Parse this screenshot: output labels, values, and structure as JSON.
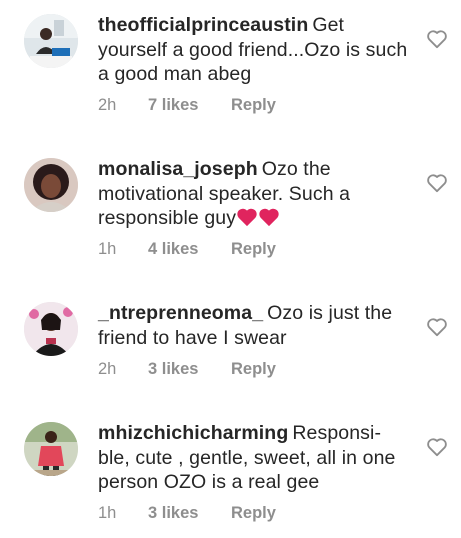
{
  "comments": [
    {
      "username": "theofficialprinceaustin",
      "text": "Get yourself a good friend...Ozo is such a good man abeg",
      "time": "2h",
      "likes": "7 likes",
      "reply": "Reply",
      "avatar_icon": "avatar-photo"
    },
    {
      "username": "monalisa_joseph",
      "text": "Ozo the motivational speaker. Such a responsible guy",
      "emoji": "❤️❤️",
      "time": "1h",
      "likes": "4 likes",
      "reply": "Reply",
      "avatar_icon": "avatar-photo"
    },
    {
      "username": "_ntreprenneoma_",
      "text": "Ozo is just the friend to have I swear",
      "time": "2h",
      "likes": "3 likes",
      "reply": "Reply",
      "avatar_icon": "avatar-photo"
    },
    {
      "username": "mhizchichicharming",
      "text": "Responsi- ble, cute , gentle, sweet, all in one person OZO is a real gee",
      "time": "1h",
      "likes": "3 likes",
      "reply": "Reply",
      "avatar_icon": "avatar-photo"
    }
  ],
  "colors": {
    "text": "#262626",
    "meta": "#8e8e8e",
    "heart_outline": "#8e8e8e",
    "emoji_heart": "#e0245e"
  },
  "icons": {
    "like": "heart-outline-icon",
    "emoji": "red-heart-emoji"
  }
}
